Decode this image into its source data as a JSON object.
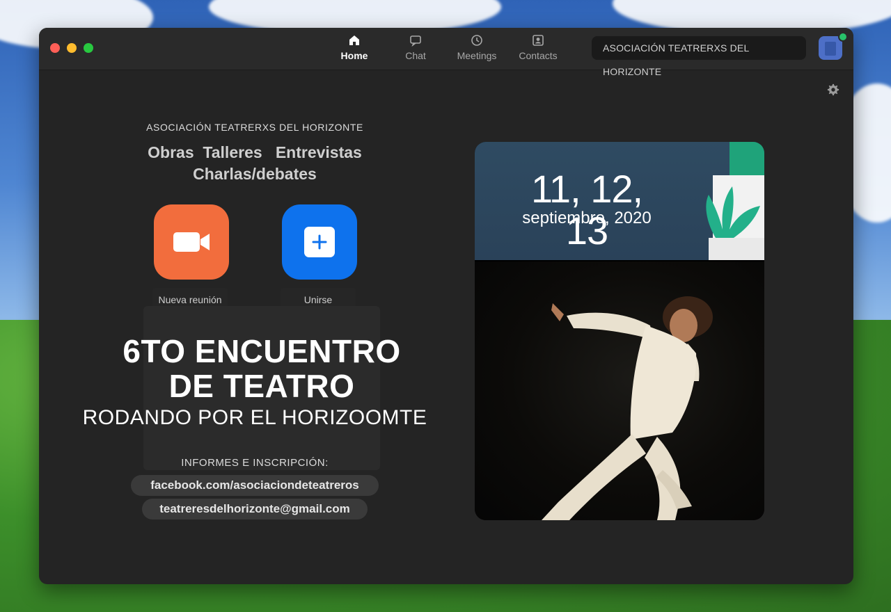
{
  "window": {
    "nav": [
      {
        "label": "Home",
        "icon": "home-icon"
      },
      {
        "label": "Chat",
        "icon": "chat-icon"
      },
      {
        "label": "Meetings",
        "icon": "clock-icon"
      },
      {
        "label": "Contacts",
        "icon": "contacts-icon"
      }
    ],
    "search_text": "ASOCIACIÓN TEATRERXS DEL HORIZONTE"
  },
  "main": {
    "org_name": "ASOCIACIÓN TEATRERXS DEL HORIZONTE",
    "topics_line1": "Obras  Talleres   Entrevistas",
    "topics_line2": "Charlas/debates",
    "new_meeting_label": "Nueva reunión",
    "join_label": "Unirse",
    "event_title_line1": "6TO ENCUENTRO",
    "event_title_line2": "DE TEATRO",
    "event_subtitle": "RODANDO POR EL HORIZOOMTE",
    "info_heading": "INFORMES E INSCRIPCIÓN:",
    "facebook": "facebook.com/asociaciondeteatreros",
    "email": "teatreresdelhorizonte@gmail.com"
  },
  "poster": {
    "dates": "11, 12, 13",
    "month_year": "septiembre, 2020"
  },
  "colors": {
    "new_meeting": "#f26d3d",
    "join": "#0e72ed",
    "window_bg": "#242424"
  }
}
